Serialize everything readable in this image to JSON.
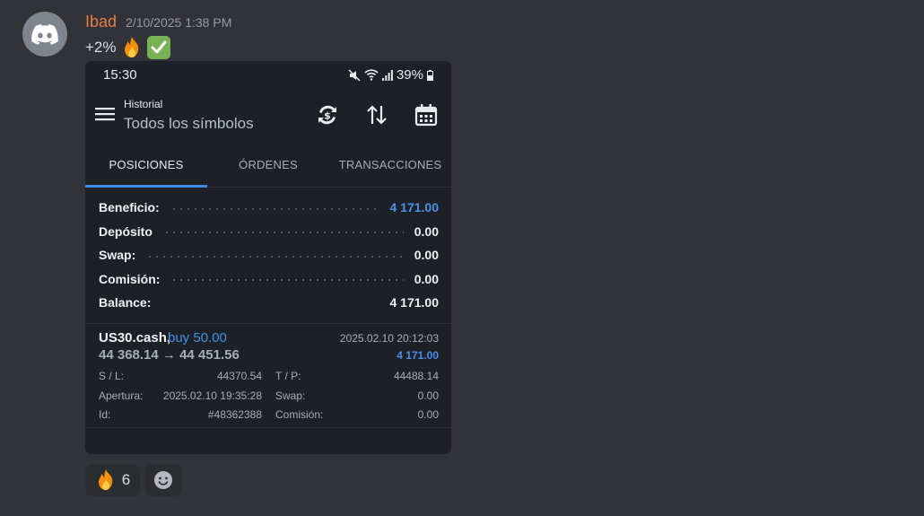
{
  "message": {
    "username": "Ibad",
    "timestamp": "2/10/2025 1:38 PM",
    "text": "+2%",
    "emojis": [
      "fire-icon",
      "check-mark-icon"
    ]
  },
  "phone": {
    "status": {
      "time": "15:30",
      "battery": "39%"
    },
    "appbar": {
      "title_small": "Historial",
      "title_big": "Todos los símbolos"
    },
    "tabs": [
      "POSICIONES",
      "ÓRDENES",
      "TRANSACCIONES"
    ],
    "summary": [
      {
        "label": "Beneficio:",
        "value": "4 171.00"
      },
      {
        "label": "Depósito",
        "value": "0.00"
      },
      {
        "label": "Swap:",
        "value": "0.00"
      },
      {
        "label": "Comisión:",
        "value": "0.00"
      },
      {
        "label": "Balance:",
        "value": "4 171.00"
      }
    ],
    "position": {
      "symbol": "US30.cash,",
      "type": "buy 50.00",
      "time": "2025.02.10 20:12:03",
      "prices": "44 368.14 → 44 451.56",
      "profit": "4 171.00",
      "sl_label": "S / L:",
      "sl_value": "44370.54",
      "tp_label": "T / P:",
      "tp_value": "44488.14",
      "open_label": "Apertura:",
      "open_value": "2025.02.10 19:35:28",
      "swap_label": "Swap:",
      "swap_value": "0.00",
      "id_label": "Id:",
      "id_value": "#48362388",
      "commission_label": "Comisión:",
      "commission_value": "0.00"
    }
  },
  "reactions": [
    {
      "icon": "fire-icon",
      "count": "6"
    },
    {
      "icon": "add-reaction-icon",
      "count": ""
    }
  ],
  "colors": {
    "accent_blue": "#4a90e8",
    "username": "#e67e4a",
    "background": "#313338"
  }
}
